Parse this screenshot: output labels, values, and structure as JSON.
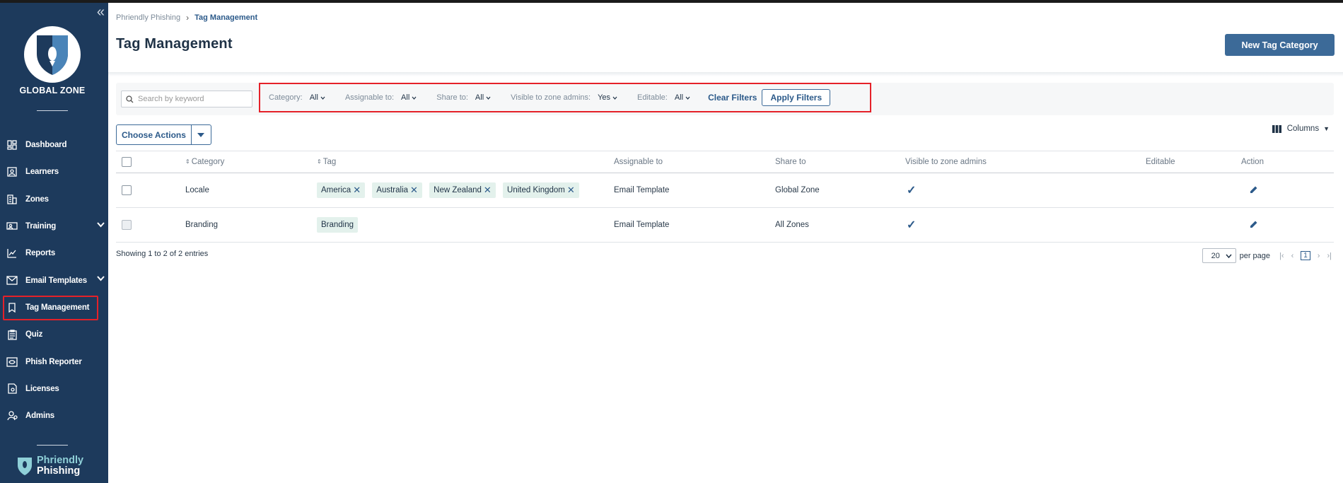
{
  "sidebar": {
    "zone_name": "GLOBAL ZONE",
    "items": [
      {
        "label": "Dashboard",
        "icon": "dashboard-icon"
      },
      {
        "label": "Learners",
        "icon": "learners-icon"
      },
      {
        "label": "Zones",
        "icon": "zones-icon"
      },
      {
        "label": "Training",
        "icon": "training-icon",
        "expandable": true
      },
      {
        "label": "Reports",
        "icon": "reports-icon"
      },
      {
        "label": "Email Templates",
        "icon": "email-icon",
        "expandable": true
      },
      {
        "label": "Tag Management",
        "icon": "bookmark-icon",
        "active": true
      },
      {
        "label": "Quiz",
        "icon": "quiz-icon"
      },
      {
        "label": "Phish Reporter",
        "icon": "phish-reporter-icon"
      },
      {
        "label": "Licenses",
        "icon": "licenses-icon"
      },
      {
        "label": "Admins",
        "icon": "admins-icon"
      }
    ],
    "brand_line1": "Phriendly",
    "brand_line2": "Phishing"
  },
  "breadcrumb": {
    "root": "Phriendly Phishing",
    "current": "Tag Management"
  },
  "page_title": "Tag Management",
  "new_button": "New Tag Category",
  "search": {
    "placeholder": "Search by keyword"
  },
  "filters": {
    "category": {
      "label": "Category:",
      "value": "All"
    },
    "assignable": {
      "label": "Assignable to:",
      "value": "All"
    },
    "share": {
      "label": "Share to:",
      "value": "All"
    },
    "visible": {
      "label": "Visible to zone admins:",
      "value": "Yes"
    },
    "editable": {
      "label": "Editable:",
      "value": "All"
    },
    "clear": "Clear Filters",
    "apply": "Apply Filters"
  },
  "choose_actions": "Choose Actions",
  "columns_button": "Columns",
  "table": {
    "headers": {
      "category": "Category",
      "tag": "Tag",
      "assignable": "Assignable to",
      "share": "Share to",
      "visible": "Visible to zone admins",
      "editable": "Editable",
      "action": "Action"
    },
    "rows": [
      {
        "category": "Locale",
        "tags": [
          "America",
          "Australia",
          "New Zealand",
          "United Kingdom"
        ],
        "assignable": "Email Template",
        "share": "Global Zone",
        "visible": true
      },
      {
        "category": "Branding",
        "tags": [
          "Branding"
        ],
        "assignable": "Email Template",
        "share": "All Zones",
        "visible": true
      }
    ]
  },
  "showing": "Showing 1 to 2 of 2 entries",
  "pagination": {
    "per_page_value": "20",
    "per_page_label": "per page",
    "current_page": "1"
  },
  "colors": {
    "sidebar_bg": "#1d3a5c",
    "accent": "#3c6a98",
    "highlight_border": "#e52129",
    "tag_bg": "#e3f1ec"
  }
}
